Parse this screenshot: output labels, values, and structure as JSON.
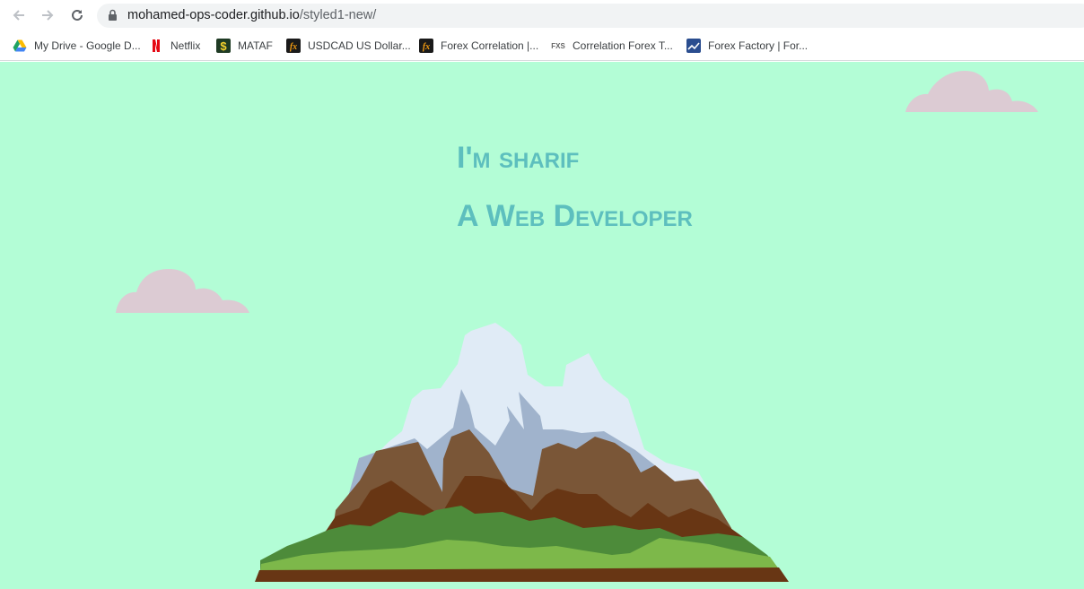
{
  "browser": {
    "url_host": "mohamed-ops-coder.github.io",
    "url_path": "/styled1-new/",
    "back_icon": "arrow-left-icon",
    "forward_icon": "arrow-right-icon",
    "reload_icon": "reload-icon",
    "lock_icon": "lock-icon"
  },
  "bookmarks": [
    {
      "label": "My Drive - Google D...",
      "icon": "google-drive-icon"
    },
    {
      "label": "Netflix",
      "icon": "netflix-icon"
    },
    {
      "label": "MATAF",
      "icon": "dollar-icon"
    },
    {
      "label": "USDCAD US Dollar...",
      "icon": "fx-icon"
    },
    {
      "label": "Forex Correlation |...",
      "icon": "fx-icon"
    },
    {
      "label": "Correlation Forex T...",
      "icon": "fxs-icon"
    },
    {
      "label": "Forex Factory | For...",
      "icon": "forex-factory-icon"
    }
  ],
  "hero": {
    "line1": "I'm sharif",
    "line2": "A Web Developer"
  },
  "colors": {
    "background": "#b3fdd6",
    "heading": "#5dbfbe",
    "cloud": "#dccbd3",
    "snow": "#e0ebf6",
    "snow_shadow": "#a0b3cc",
    "rock_light": "#7a5637",
    "rock_dark": "#683614",
    "grass_dark": "#4d8b3a",
    "grass_light": "#7db84a"
  }
}
